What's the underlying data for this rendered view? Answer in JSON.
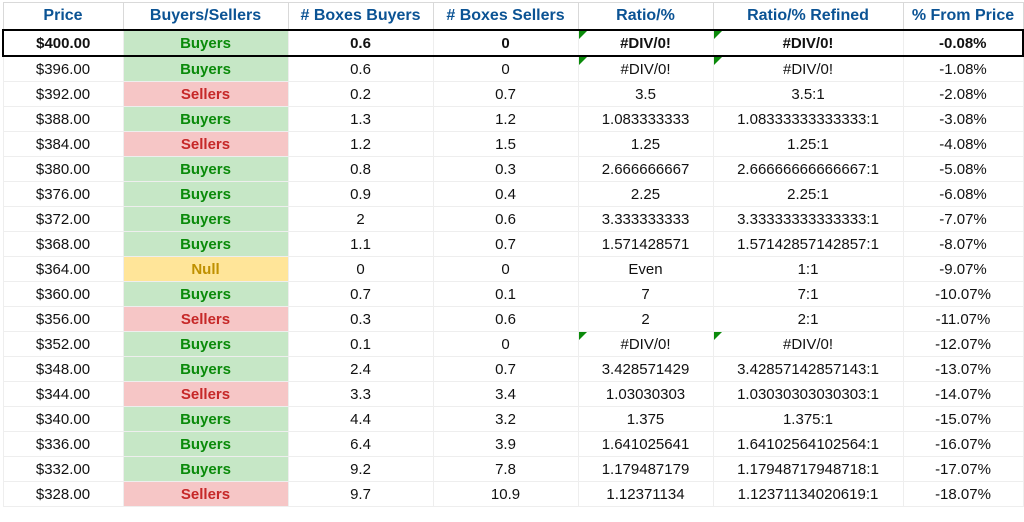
{
  "headers": {
    "price": "Price",
    "bs": "Buyers/Sellers",
    "boxb": "# Boxes Buyers",
    "boxs": "# Boxes Sellers",
    "ratio": "Ratio/%",
    "ratior": "Ratio/% Refined",
    "pct": "% From Price"
  },
  "rows": [
    {
      "price": "$400.00",
      "bs": "Buyers",
      "bstype": "buyers",
      "boxb": "0.6",
      "boxs": "0",
      "ratio": "#DIV/0!",
      "ratior": "#DIV/0!",
      "pct": "-0.08%",
      "hl": true,
      "flag": true
    },
    {
      "price": "$396.00",
      "bs": "Buyers",
      "bstype": "buyers",
      "boxb": "0.6",
      "boxs": "0",
      "ratio": "#DIV/0!",
      "ratior": "#DIV/0!",
      "pct": "-1.08%",
      "flag": true
    },
    {
      "price": "$392.00",
      "bs": "Sellers",
      "bstype": "sellers",
      "boxb": "0.2",
      "boxs": "0.7",
      "ratio": "3.5",
      "ratior": "3.5:1",
      "pct": "-2.08%"
    },
    {
      "price": "$388.00",
      "bs": "Buyers",
      "bstype": "buyers",
      "boxb": "1.3",
      "boxs": "1.2",
      "ratio": "1.083333333",
      "ratior": "1.08333333333333:1",
      "pct": "-3.08%"
    },
    {
      "price": "$384.00",
      "bs": "Sellers",
      "bstype": "sellers",
      "boxb": "1.2",
      "boxs": "1.5",
      "ratio": "1.25",
      "ratior": "1.25:1",
      "pct": "-4.08%"
    },
    {
      "price": "$380.00",
      "bs": "Buyers",
      "bstype": "buyers",
      "boxb": "0.8",
      "boxs": "0.3",
      "ratio": "2.666666667",
      "ratior": "2.66666666666667:1",
      "pct": "-5.08%"
    },
    {
      "price": "$376.00",
      "bs": "Buyers",
      "bstype": "buyers",
      "boxb": "0.9",
      "boxs": "0.4",
      "ratio": "2.25",
      "ratior": "2.25:1",
      "pct": "-6.08%"
    },
    {
      "price": "$372.00",
      "bs": "Buyers",
      "bstype": "buyers",
      "boxb": "2",
      "boxs": "0.6",
      "ratio": "3.333333333",
      "ratior": "3.33333333333333:1",
      "pct": "-7.07%"
    },
    {
      "price": "$368.00",
      "bs": "Buyers",
      "bstype": "buyers",
      "boxb": "1.1",
      "boxs": "0.7",
      "ratio": "1.571428571",
      "ratior": "1.57142857142857:1",
      "pct": "-8.07%"
    },
    {
      "price": "$364.00",
      "bs": "Null",
      "bstype": "null",
      "boxb": "0",
      "boxs": "0",
      "ratio": "Even",
      "ratior": "1:1",
      "pct": "-9.07%"
    },
    {
      "price": "$360.00",
      "bs": "Buyers",
      "bstype": "buyers",
      "boxb": "0.7",
      "boxs": "0.1",
      "ratio": "7",
      "ratior": "7:1",
      "pct": "-10.07%"
    },
    {
      "price": "$356.00",
      "bs": "Sellers",
      "bstype": "sellers",
      "boxb": "0.3",
      "boxs": "0.6",
      "ratio": "2",
      "ratior": "2:1",
      "pct": "-11.07%"
    },
    {
      "price": "$352.00",
      "bs": "Buyers",
      "bstype": "buyers",
      "boxb": "0.1",
      "boxs": "0",
      "ratio": "#DIV/0!",
      "ratior": "#DIV/0!",
      "pct": "-12.07%",
      "flag": true
    },
    {
      "price": "$348.00",
      "bs": "Buyers",
      "bstype": "buyers",
      "boxb": "2.4",
      "boxs": "0.7",
      "ratio": "3.428571429",
      "ratior": "3.42857142857143:1",
      "pct": "-13.07%"
    },
    {
      "price": "$344.00",
      "bs": "Sellers",
      "bstype": "sellers",
      "boxb": "3.3",
      "boxs": "3.4",
      "ratio": "1.03030303",
      "ratior": "1.03030303030303:1",
      "pct": "-14.07%"
    },
    {
      "price": "$340.00",
      "bs": "Buyers",
      "bstype": "buyers",
      "boxb": "4.4",
      "boxs": "3.2",
      "ratio": "1.375",
      "ratior": "1.375:1",
      "pct": "-15.07%"
    },
    {
      "price": "$336.00",
      "bs": "Buyers",
      "bstype": "buyers",
      "boxb": "6.4",
      "boxs": "3.9",
      "ratio": "1.641025641",
      "ratior": "1.64102564102564:1",
      "pct": "-16.07%"
    },
    {
      "price": "$332.00",
      "bs": "Buyers",
      "bstype": "buyers",
      "boxb": "9.2",
      "boxs": "7.8",
      "ratio": "1.179487179",
      "ratior": "1.17948717948718:1",
      "pct": "-17.07%"
    },
    {
      "price": "$328.00",
      "bs": "Sellers",
      "bstype": "sellers",
      "boxb": "9.7",
      "boxs": "10.9",
      "ratio": "1.12371134",
      "ratior": "1.12371134020619:1",
      "pct": "-18.07%"
    }
  ]
}
